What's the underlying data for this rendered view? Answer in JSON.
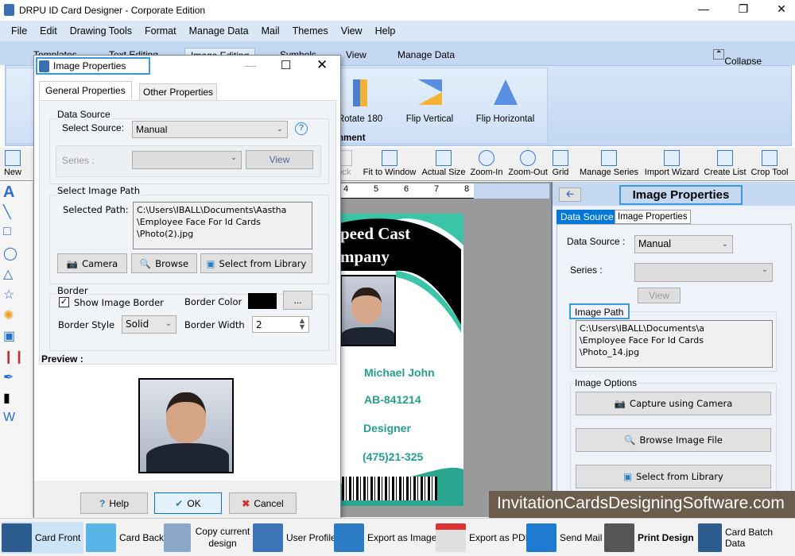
{
  "app": {
    "title": "DRPU ID Card Designer - Corporate Edition"
  },
  "menu": [
    "File",
    "Edit",
    "Drawing Tools",
    "Format",
    "Manage Data",
    "Mail",
    "Themes",
    "View",
    "Help"
  ],
  "ribbon_tabs": {
    "templates": "Templates",
    "text": "Text Editing",
    "image": "Image Editing",
    "symbols": "Symbols",
    "view": "View",
    "manage": "Manage Data",
    "collapse": "Collapse"
  },
  "ribbon": {
    "rotate": "Rotate 180",
    "flip_v": "Flip Vertical",
    "flip_h": "Flip Horizontal",
    "group": "gnment"
  },
  "toolbar": {
    "new": "New",
    "open": "O",
    "lock": "ock",
    "fit": "Fit to Window",
    "actual": "Actual Size",
    "zin": "Zoom-In",
    "zout": "Zoom-Out",
    "grid": "Grid",
    "series": "Manage Series",
    "import": "Import Wizard",
    "list": "Create List",
    "crop": "Crop Tool"
  },
  "ruler": [
    "4",
    "5",
    "6",
    "7",
    "8"
  ],
  "card": {
    "company1": "peed Cast",
    "company2": "mpany",
    "name": "Michael John",
    "id": "AB-841214",
    "role": "Designer",
    "phone": "(475)21-325"
  },
  "dialog": {
    "title": "Image Properties",
    "tabs": [
      "General  Properties",
      "Other Properties"
    ],
    "data_source_label": "Data Source",
    "select_source_label": "Select Source:",
    "select_source_value": "Manual",
    "series_label": "Series :",
    "view": "View",
    "image_path_group": "Select Image Path",
    "selected_path_label": "Selected Path:",
    "path_lines": [
      "C:\\Users\\IBALL\\Documents\\Aastha",
      "\\Employee Face For Id Cards",
      "\\Photo(2).jpg"
    ],
    "camera": "Camera",
    "browse": "Browse",
    "library": "Select from Library",
    "border_group": "Border",
    "show_border": "Show Image Border",
    "border_color": "Border Color",
    "color_value": "#000000",
    "dots": "...",
    "border_style_label": "Border Style",
    "border_style": "Solid",
    "border_width_label": "Border Width",
    "border_width": "2",
    "preview": "Preview :",
    "help": "Help",
    "ok": "OK",
    "cancel": "Cancel"
  },
  "panel": {
    "title": "Image Properties",
    "tabs": [
      "Data Source",
      "Image Properties"
    ],
    "ds_label": "Data Source :",
    "ds_value": "Manual",
    "series_label": "Series :",
    "view": "View",
    "path_label": "Image Path",
    "path_lines": [
      "C:\\Users\\IBALL\\Documents\\a",
      "\\Employee Face For Id Cards",
      "\\Photo_14.jpg"
    ],
    "options_label": "Image Options",
    "camera": "Capture using Camera",
    "browse": "Browse Image File",
    "library": "Select from Library"
  },
  "bottom": [
    "Card Front",
    "Card Back",
    "Copy current design",
    "User Profile",
    "Export as Image",
    "Export as PDF",
    "Send Mail",
    "Print Design",
    "Card Batch Data"
  ],
  "watermark": "InvitationCardsDesigningSoftware.com",
  "colors": {
    "accent": "#0078d7",
    "teal": "#2a9d8f",
    "card_green": "#3cc4a8"
  }
}
